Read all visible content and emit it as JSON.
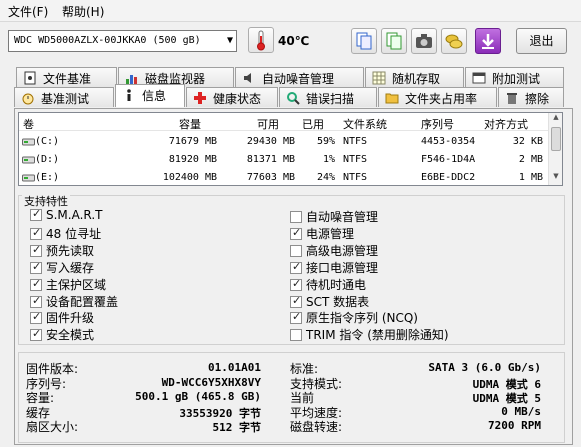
{
  "menu": {
    "file": "文件(F)",
    "help": "帮助(H)"
  },
  "toolbar": {
    "drive": "WDC WD5000AZLX-00JKKA0 (500 gB)",
    "temperature": "40℃",
    "exit_label": "退出",
    "icons": [
      "copy-icon",
      "copy-alt-icon",
      "camera-icon",
      "coins-icon",
      "download-icon"
    ]
  },
  "tabs_top": [
    "文件基准",
    "磁盘监视器",
    "自动噪音管理",
    "随机存取",
    "附加测试"
  ],
  "tabs_bottom": [
    "基准测试",
    "信息",
    "健康状态",
    "错误扫描",
    "文件夹占用率",
    "擦除"
  ],
  "active_tab": "信息",
  "partitions": {
    "headers": [
      "卷",
      "容量",
      "可用",
      "已用",
      "文件系统",
      "序列号",
      "对齐方式"
    ],
    "rows": [
      [
        "(C:)",
        "71679 MB",
        "29430 MB",
        "59%",
        "NTFS",
        "4453-0354",
        "32 KB"
      ],
      [
        "(D:)",
        "81920 MB",
        "81371 MB",
        "1%",
        "NTFS",
        "F546-1D4A",
        "2 MB"
      ],
      [
        "(E:)",
        "102400 MB",
        "77603 MB",
        "24%",
        "NTFS",
        "E6BE-DDC2",
        "1 MB"
      ]
    ]
  },
  "features": {
    "title": "支持特性",
    "left": [
      {
        "label": "S.M.A.R.T",
        "checked": true
      },
      {
        "label": "48 位寻址",
        "checked": true
      },
      {
        "label": "预先读取",
        "checked": true
      },
      {
        "label": "写入缓存",
        "checked": true
      },
      {
        "label": "主保护区域",
        "checked": true
      },
      {
        "label": "设备配置覆盖",
        "checked": true
      },
      {
        "label": "固件升级",
        "checked": true
      },
      {
        "label": "安全模式",
        "checked": true
      }
    ],
    "right": [
      {
        "label": "自动噪音管理",
        "checked": false
      },
      {
        "label": "电源管理",
        "checked": true
      },
      {
        "label": "高级电源管理",
        "checked": false
      },
      {
        "label": "接口电源管理",
        "checked": true
      },
      {
        "label": "待机时通电",
        "checked": true
      },
      {
        "label": "SCT 数据表",
        "checked": true
      },
      {
        "label": "原生指令序列 (NCQ)",
        "checked": true
      },
      {
        "label": "TRIM 指令 (禁用删除通知)",
        "checked": false
      }
    ]
  },
  "info": {
    "left": [
      {
        "label": "固件版本:",
        "value": "01.01A01"
      },
      {
        "label": "序列号:",
        "value": "WD-WCC6Y5XHX8VY"
      },
      {
        "label": "容量:",
        "value": "500.1 gB (465.8 GB)"
      },
      {
        "label": "缓存",
        "value": "33553920 字节"
      },
      {
        "label": "扇区大小:",
        "value": "512 字节"
      }
    ],
    "right": [
      {
        "label": "标准:",
        "value": "SATA 3 (6.0 Gb/s)"
      },
      {
        "label": "支持模式:",
        "value": "UDMA 模式 6"
      },
      {
        "label": "当前",
        "value": "UDMA 模式 5"
      },
      {
        "label": "平均速度:",
        "value": "0 MB/s"
      },
      {
        "label": "磁盘转速:",
        "value": "7200 RPM"
      }
    ]
  }
}
